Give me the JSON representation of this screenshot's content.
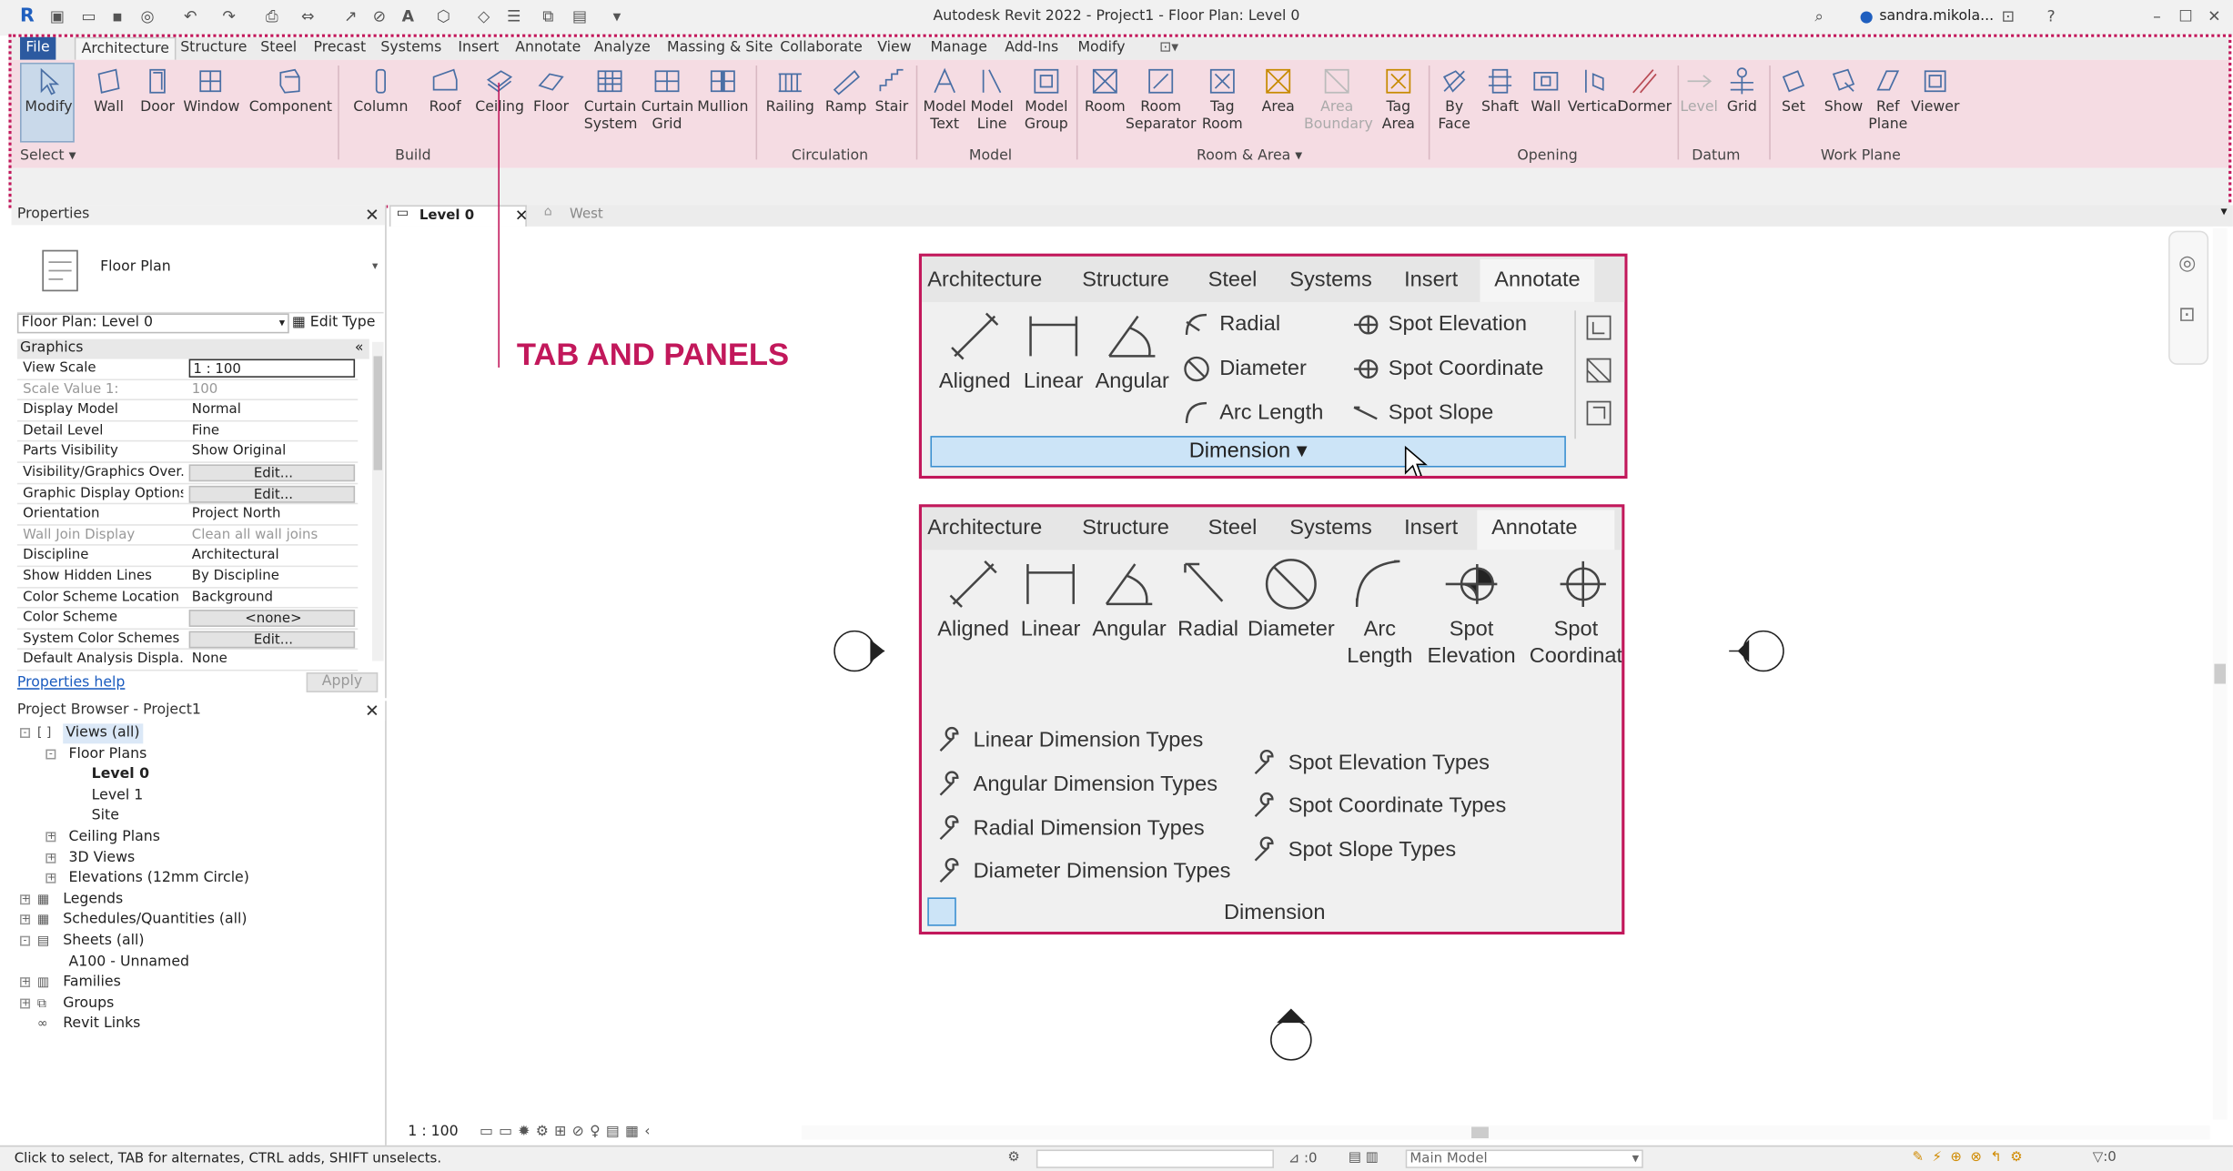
{
  "app": {
    "title": "Autodesk Revit 2022 - Project1 - Floor Plan: Level 0",
    "user": "sandra.mikola..."
  },
  "tabs": [
    "File",
    "Architecture",
    "Structure",
    "Steel",
    "Precast",
    "Systems",
    "Insert",
    "Annotate",
    "Analyze",
    "Massing & Site",
    "Collaborate",
    "View",
    "Manage",
    "Add-Ins",
    "Modify"
  ],
  "ribbon": {
    "buttons": [
      "Modify",
      "Wall",
      "Door",
      "Window",
      "Component",
      "Column",
      "Roof",
      "Ceiling",
      "Floor",
      "Curtain System",
      "Curtain Grid",
      "Mullion",
      "Railing",
      "Ramp",
      "Stair",
      "Model Text",
      "Model Line",
      "Model Group",
      "Room",
      "Room Separator",
      "Tag Room",
      "Area",
      "Area Boundary",
      "Tag Area",
      "By Face",
      "Shaft",
      "Wall",
      "Vertical",
      "Dormer",
      "Level",
      "Grid",
      "Set",
      "Show",
      "Ref Plane",
      "Viewer"
    ],
    "panels": [
      "Select",
      "Build",
      "Circulation",
      "Model",
      "Room & Area",
      "Opening",
      "Datum",
      "Work Plane"
    ]
  },
  "properties": {
    "title": "Properties",
    "type_name": "Floor Plan",
    "selector": "Floor Plan: Level 0",
    "edit_type": "Edit Type",
    "group": "Graphics",
    "rows": [
      {
        "k": "View Scale",
        "v": "1 : 100"
      },
      {
        "k": "Scale Value    1:",
        "v": "100"
      },
      {
        "k": "Display Model",
        "v": "Normal"
      },
      {
        "k": "Detail Level",
        "v": "Fine"
      },
      {
        "k": "Parts Visibility",
        "v": "Show Original"
      },
      {
        "k": "Visibility/Graphics Over...",
        "v": "Edit..."
      },
      {
        "k": "Graphic Display Options",
        "v": "Edit..."
      },
      {
        "k": "Orientation",
        "v": "Project North"
      },
      {
        "k": "Wall Join Display",
        "v": "Clean all wall joins"
      },
      {
        "k": "Discipline",
        "v": "Architectural"
      },
      {
        "k": "Show Hidden Lines",
        "v": "By Discipline"
      },
      {
        "k": "Color Scheme Location",
        "v": "Background"
      },
      {
        "k": "Color Scheme",
        "v": "<none>"
      },
      {
        "k": "System Color Schemes",
        "v": "Edit..."
      },
      {
        "k": "Default Analysis Displa...",
        "v": "None"
      }
    ],
    "help": "Properties help",
    "apply": "Apply"
  },
  "browser": {
    "title": "Project Browser - Project1",
    "nodes": [
      "Views (all)",
      "Floor Plans",
      "Level 0",
      "Level 1",
      "Site",
      "Ceiling Plans",
      "3D Views",
      "Elevations (12mm Circle)",
      "Legends",
      "Schedules/Quantities (all)",
      "Sheets (all)",
      "A100 - Unnamed",
      "Families",
      "Groups",
      "Revit Links"
    ]
  },
  "viewtabs": [
    "Level 0",
    "West"
  ],
  "annotation": "TAB AND PANELS",
  "inset1": {
    "tabs": [
      "Architecture",
      "Structure",
      "Steel",
      "Systems",
      "Insert",
      "Annotate"
    ],
    "big": [
      "Aligned",
      "Linear",
      "Angular"
    ],
    "small": [
      "Radial",
      "Diameter",
      "Arc Length",
      "Spot  Elevation",
      "Spot  Coordinate",
      "Spot  Slope"
    ],
    "panel": "Dimension"
  },
  "inset2": {
    "tabs": [
      "Architecture",
      "Structure",
      "Steel",
      "Systems",
      "Insert",
      "Annotate"
    ],
    "big": [
      "Aligned",
      "Linear",
      "Angular",
      "Radial",
      "Diameter",
      "Arc Length",
      "Spot Elevation",
      "Spot Coordinat"
    ],
    "types_left": [
      "Linear Dimension Types",
      "Angular Dimension Types",
      "Radial Dimension Types",
      "Diameter Dimension Types"
    ],
    "types_right": [
      "Spot Elevation Types",
      "Spot Coordinate Types",
      "Spot Slope Types"
    ],
    "panel": "Dimension"
  },
  "view": {
    "scale": "1 : 100"
  },
  "status": {
    "hint": "Click to select, TAB for alternates, CTRL adds, SHIFT unselects.",
    "coord": ":0",
    "model": "Main Model",
    "filter": ":0"
  },
  "colors": {
    "accent": "#c2185b",
    "ribbon": "#f5dce3",
    "file_tab": "#2c5aa0"
  }
}
